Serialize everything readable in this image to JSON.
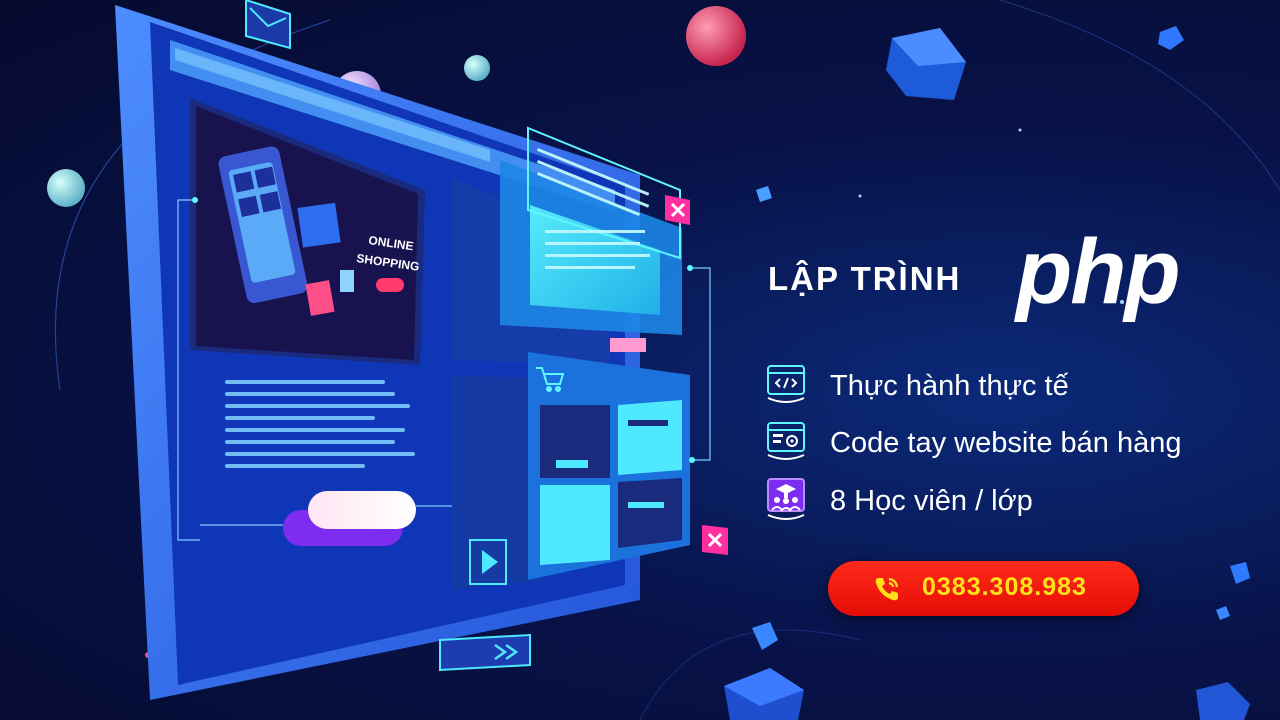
{
  "headline": {
    "prefix": "LẬP TRÌNH",
    "logo_text": "php"
  },
  "features": [
    {
      "icon": "code-window-icon",
      "label": "Thực hành thực tế"
    },
    {
      "icon": "web-settings-icon",
      "label": "Code tay website bán hàng"
    },
    {
      "icon": "students-group-icon",
      "label": "8 Học viên / lớp"
    }
  ],
  "contact": {
    "icon": "phone-icon",
    "phone": "0383.308.983"
  },
  "illustration": {
    "screen_text": [
      "ONLINE",
      "SHOPPING"
    ],
    "icons": [
      "mail-icon",
      "cart-icon",
      "play-icon",
      "close-icon"
    ]
  },
  "colors": {
    "background": "#08134a",
    "accent_cyan": "#3ff2ff",
    "button": "#e8130a",
    "phone_text": "#ffe21a",
    "highlight": "#7c2df0"
  }
}
